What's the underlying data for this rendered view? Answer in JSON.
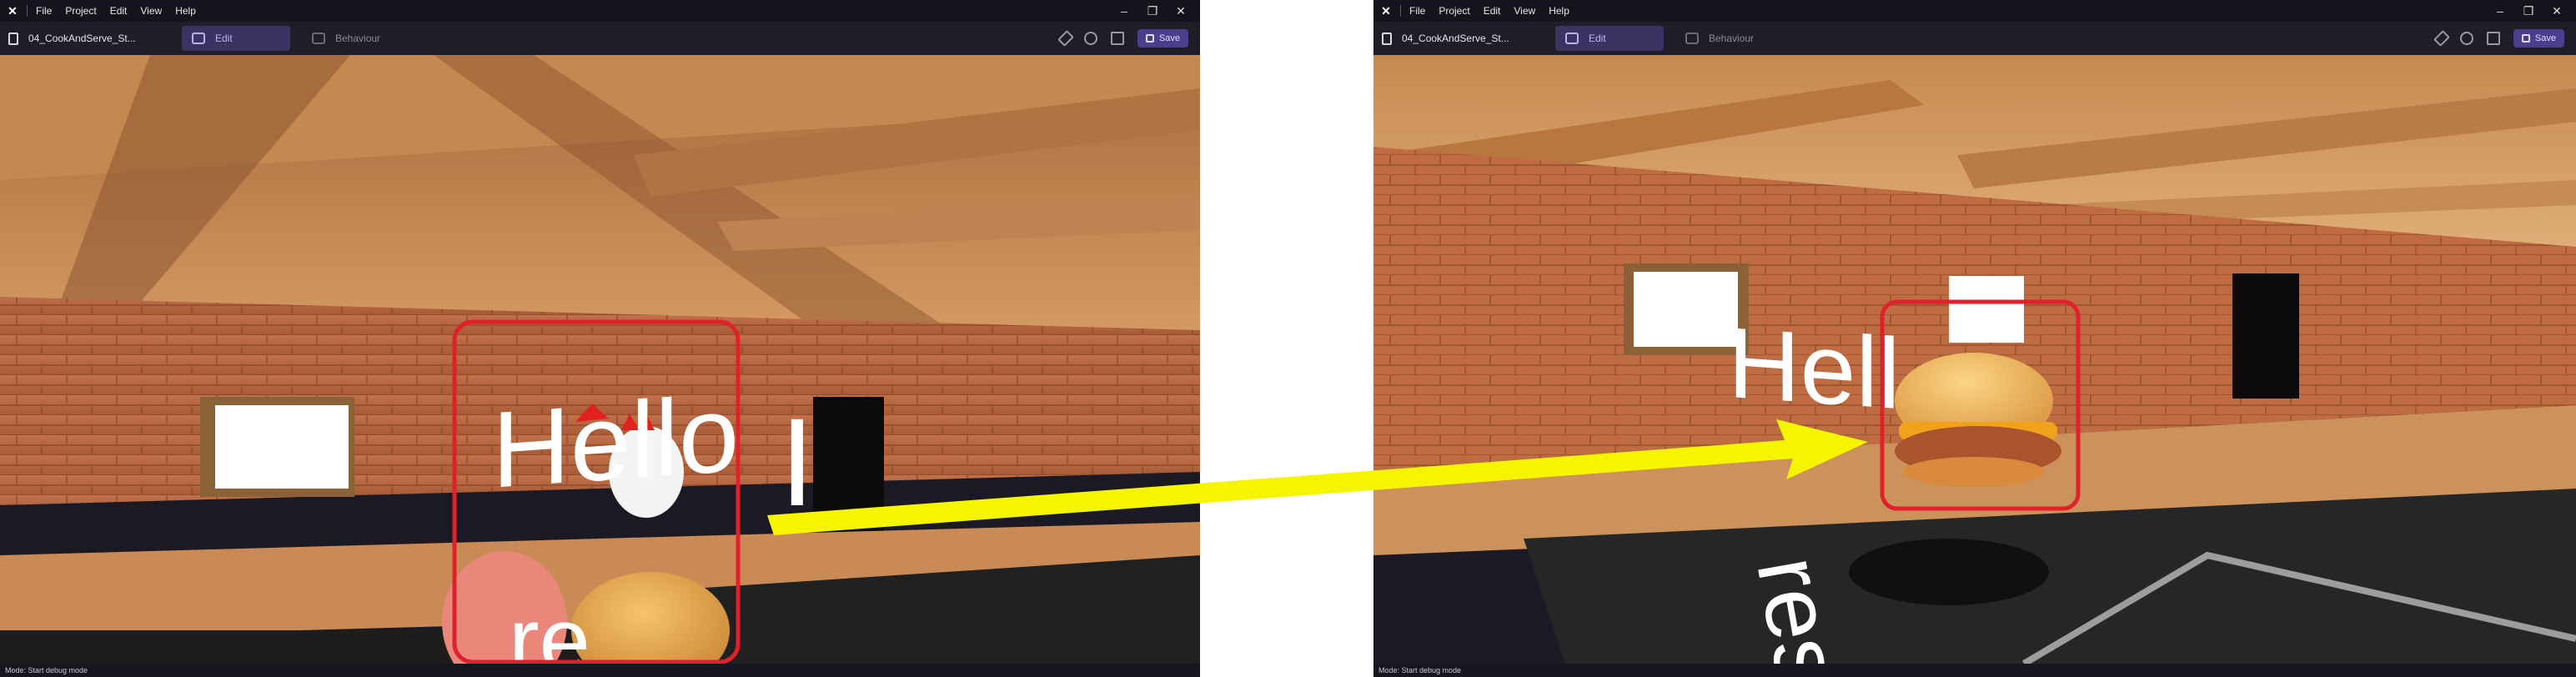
{
  "windows": [
    {
      "menu": [
        "File",
        "Project",
        "Edit",
        "View",
        "Help"
      ],
      "project_name": "04_CookAndServe_St...",
      "tabs": [
        {
          "label": "Edit",
          "active": true
        },
        {
          "label": "Behaviour",
          "active": false
        }
      ],
      "save_label": "Save",
      "scene_text": {
        "hello": "Hello",
        "extra": "I",
        "bottom": "re"
      },
      "status": "Mode: Start debug mode"
    },
    {
      "menu": [
        "File",
        "Project",
        "Edit",
        "View",
        "Help"
      ],
      "project_name": "04_CookAndServe_St...",
      "tabs": [
        {
          "label": "Edit",
          "active": true
        },
        {
          "label": "Behaviour",
          "active": false
        }
      ],
      "save_label": "Save",
      "scene_text": {
        "hello": "Hell",
        "bottom": "res"
      },
      "status": "Mode: Start debug mode"
    }
  ],
  "colors": {
    "accent": "#3b3362",
    "highlight_box": "#e0202a",
    "arrow": "#f5f500",
    "wood": "#b87a47",
    "brick": "#b5643f"
  },
  "icons": [
    "app-logo-icon",
    "document-icon",
    "edit-icon",
    "behaviour-icon",
    "wrench-icon",
    "play-icon",
    "save-disk-icon",
    "minimize-icon",
    "restore-icon",
    "close-icon"
  ]
}
